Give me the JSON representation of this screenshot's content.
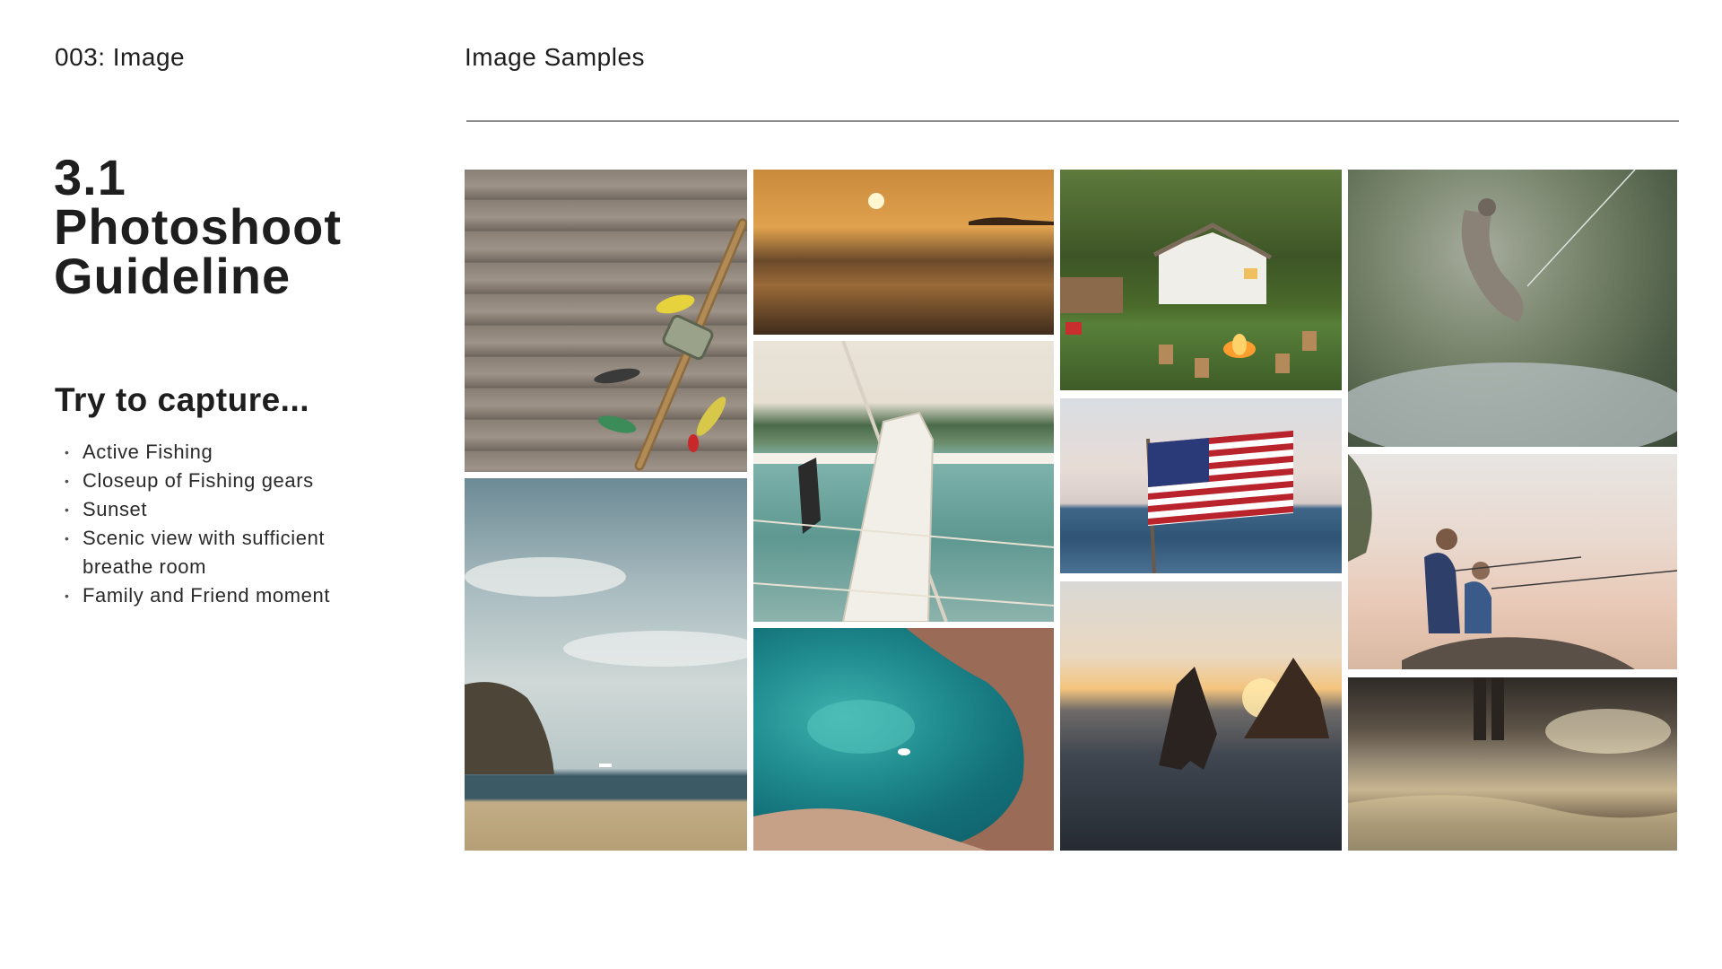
{
  "header": {
    "section_label": "003: Image",
    "title": "Image Samples"
  },
  "guideline": {
    "title_lines": [
      "3.1",
      "Photoshoot",
      "Guideline"
    ],
    "subheading": "Try to capture...",
    "items": [
      "Active Fishing",
      "Closeup of Fishing gears",
      "Sunset",
      "Scenic view with sufficient breathe room",
      "Family and Friend moment"
    ]
  },
  "photos": [
    {
      "id": "fishing-gear-on-wood",
      "depicts": "fishing rod and lures on wooden planks"
    },
    {
      "id": "beach-cove-sky",
      "depicts": "cloudy sky over a rocky beach cove"
    },
    {
      "id": "sea-sunset",
      "depicts": "sun setting over calm sea"
    },
    {
      "id": "boat-railing-palms",
      "depicts": "boat railing with fishing rod and palm trees"
    },
    {
      "id": "aerial-reef-boat",
      "depicts": "aerial view of turquoise reef with small boat"
    },
    {
      "id": "cabin-campfire",
      "depicts": "lakeside cabin with campfire and stumps"
    },
    {
      "id": "american-flag-sea",
      "depicts": "american flag waving over the ocean"
    },
    {
      "id": "sea-stacks-sunset",
      "depicts": "sea stacks at sunset"
    },
    {
      "id": "leaping-fish",
      "depicts": "fish jumping out of the water on a line"
    },
    {
      "id": "father-son-fishing",
      "depicts": "father and son fishing from a rock"
    },
    {
      "id": "wading-sunset-shore",
      "depicts": "person wading at the shore at sunset"
    }
  ]
}
